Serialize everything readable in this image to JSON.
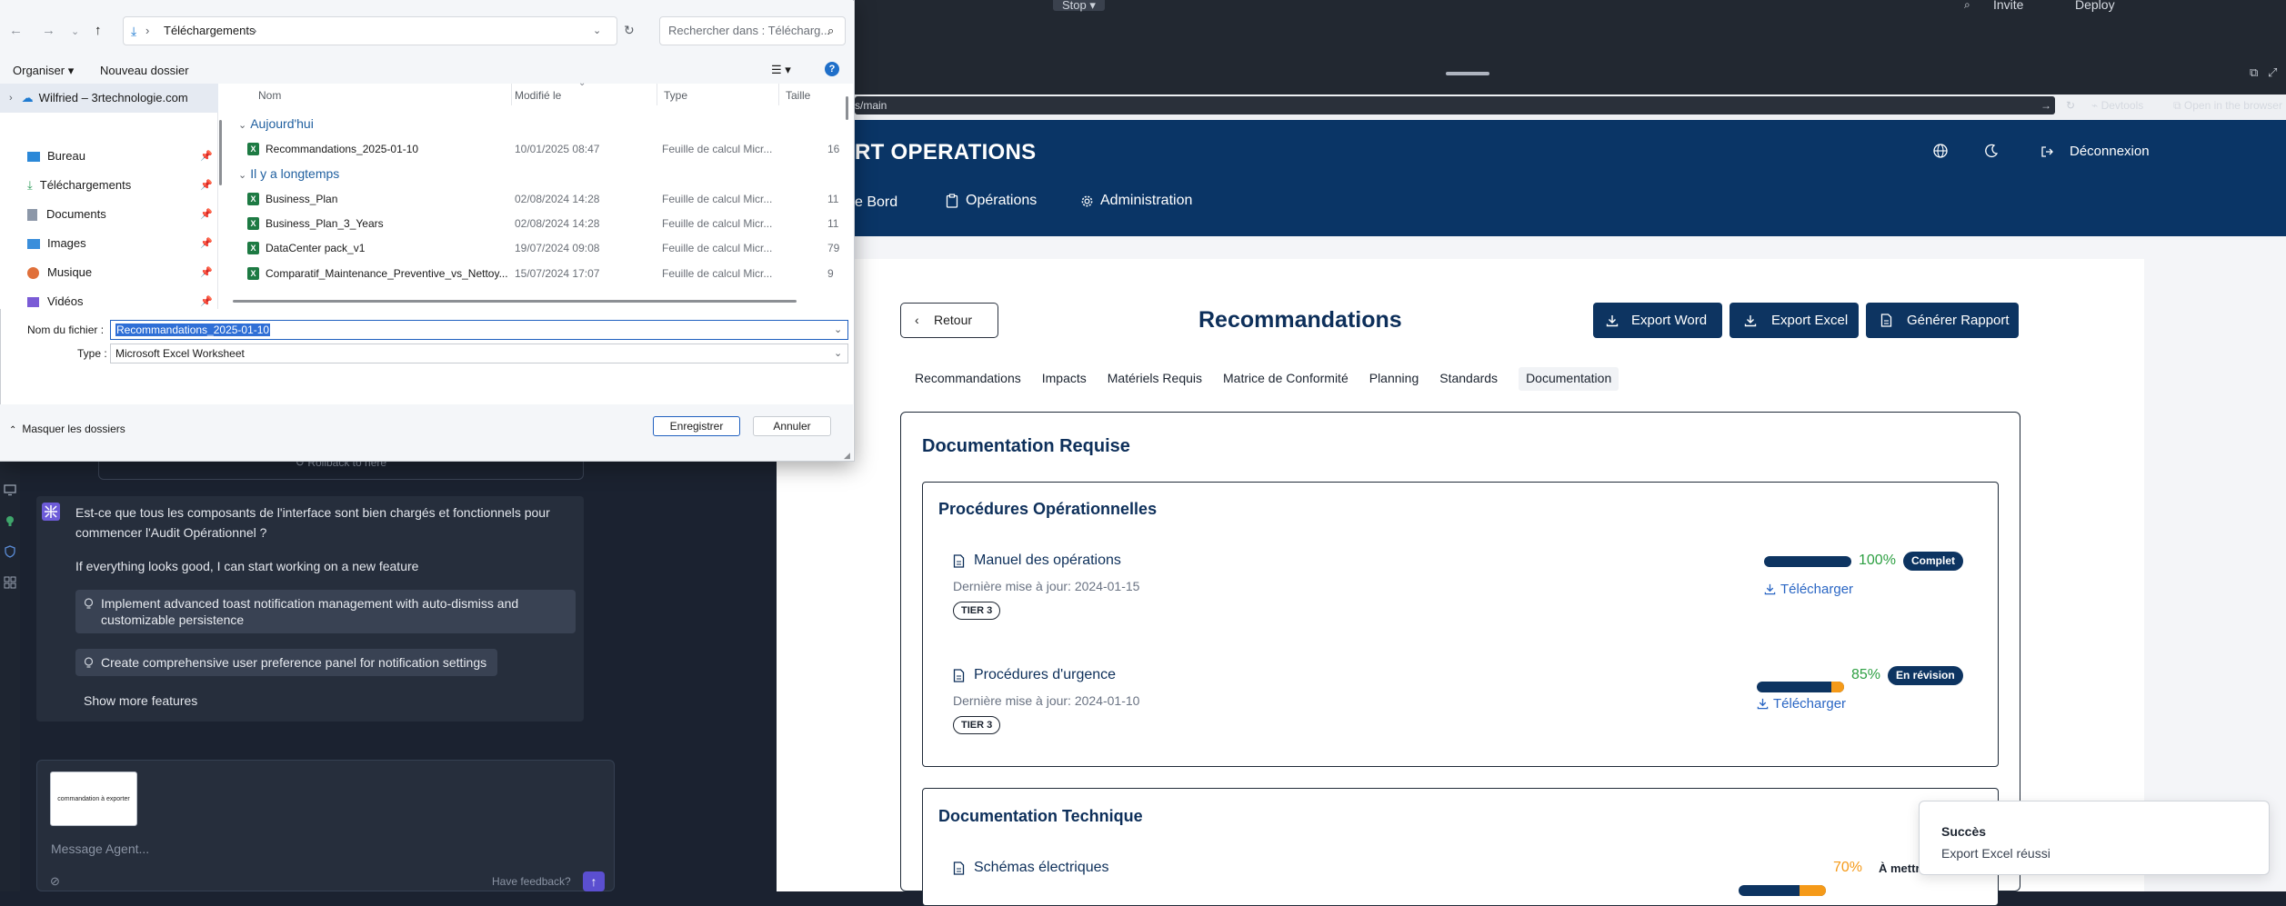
{
  "topbar": {
    "stop_label": "Stop",
    "invite_label": "Invite",
    "deploy_label": "Deploy"
  },
  "chat": {
    "rollback_label": "Rollback to here",
    "message_line1": "Est-ce que tous les composants de l'interface sont bien chargés et fonctionnels pour",
    "message_line2": "commencer l'Audit Opérationnel ?",
    "message_line3": "If everything looks good, I can start working on a new feature",
    "suggestions": [
      {
        "line1": "Implement advanced toast notification management with auto-dismiss and",
        "line2": "customizable persistence"
      },
      {
        "line1": "Create comprehensive user preference panel for notification settings",
        "line2": ""
      }
    ],
    "show_more": "Show more features",
    "attachment_label": "commandation à exporter",
    "composer_placeholder": "Message Agent...",
    "feedback_label": "Have feedback?"
  },
  "browser": {
    "url": "s/main",
    "devtools_label": "Devtools",
    "open_label": "Open in the browser"
  },
  "app": {
    "brand": "RT OPERATIONS",
    "nav": {
      "dashboard": "e Bord",
      "operations": "Opérations",
      "admin": "Administration"
    },
    "logout_label": "Déconnexion"
  },
  "page": {
    "back_label": "Retour",
    "title": "Recommandations",
    "export_word": "Export Word",
    "export_excel": "Export Excel",
    "report_label": "Générer Rapport",
    "tabs": [
      "Recommandations",
      "Impacts",
      "Matériels Requis",
      "Matrice de Conformité",
      "Planning",
      "Standards",
      "Documentation"
    ],
    "doc_title": "Documentation Requise",
    "sections": [
      {
        "title": "Procédures Opérationnelles",
        "docs": [
          {
            "name": "Manuel des opérations",
            "date": "Dernière mise à jour: 2024-01-15",
            "tier": "TIER 3",
            "percent": 100,
            "percent_label": "100%",
            "status": "Complet",
            "download": "Télécharger"
          },
          {
            "name": "Procédures d'urgence",
            "date": "Dernière mise à jour: 2024-01-10",
            "tier": "TIER 3",
            "percent": 85,
            "percent_label": "85%",
            "status": "En révision",
            "download": "Télécharger"
          }
        ]
      },
      {
        "title": "Documentation Technique",
        "docs": [
          {
            "name": "Schémas électriques",
            "date": "",
            "tier": "",
            "percent": 70,
            "percent_label": "70%",
            "status": "À mettr",
            "download": ""
          }
        ]
      }
    ],
    "colors": {
      "navy": "#0d3461",
      "green": "#2ea043",
      "orange": "#f59a19",
      "link": "#2a66c4"
    }
  },
  "toast": {
    "title": "Succès",
    "message": "Export Excel réussi"
  },
  "dialog": {
    "breadcrumb": "Téléchargements",
    "search_placeholder": "Rechercher dans : Télécharg...",
    "organize_label": "Organiser",
    "new_folder_label": "Nouveau dossier",
    "nav_items": [
      {
        "label": "Wilfried – 3rtechnologie.com",
        "icon": "cloud-icon"
      },
      {
        "label": "Bureau",
        "icon": "desktop-icon"
      },
      {
        "label": "Téléchargements",
        "icon": "download-icon"
      },
      {
        "label": "Documents",
        "icon": "document-icon"
      },
      {
        "label": "Images",
        "icon": "image-icon"
      },
      {
        "label": "Musique",
        "icon": "music-icon"
      },
      {
        "label": "Vidéos",
        "icon": "video-icon"
      }
    ],
    "columns": {
      "name": "Nom",
      "modified": "Modifié le",
      "type": "Type",
      "size": "Taille"
    },
    "groups": [
      {
        "label": "Aujourd'hui",
        "files": [
          {
            "name": "Recommandations_2025-01-10",
            "date": "10/01/2025 08:47",
            "type": "Feuille de calcul Micr...",
            "size": "16"
          }
        ]
      },
      {
        "label": "Il y a longtemps",
        "files": [
          {
            "name": "Business_Plan",
            "date": "02/08/2024 14:28",
            "type": "Feuille de calcul Micr...",
            "size": "11"
          },
          {
            "name": "Business_Plan_3_Years",
            "date": "02/08/2024 14:28",
            "type": "Feuille de calcul Micr...",
            "size": "11"
          },
          {
            "name": "DataCenter pack_v1",
            "date": "19/07/2024 09:08",
            "type": "Feuille de calcul Micr...",
            "size": "79"
          },
          {
            "name": "Comparatif_Maintenance_Preventive_vs_Nettoy...",
            "date": "15/07/2024 17:07",
            "type": "Feuille de calcul Micr...",
            "size": "9"
          }
        ]
      }
    ],
    "filename_label": "Nom du fichier :",
    "filename_value": "Recommandations_2025-01-10",
    "type_label": "Type :",
    "type_value": "Microsoft Excel Worksheet",
    "hide_folders_label": "Masquer les dossiers",
    "save_label": "Enregistrer",
    "cancel_label": "Annuler"
  }
}
